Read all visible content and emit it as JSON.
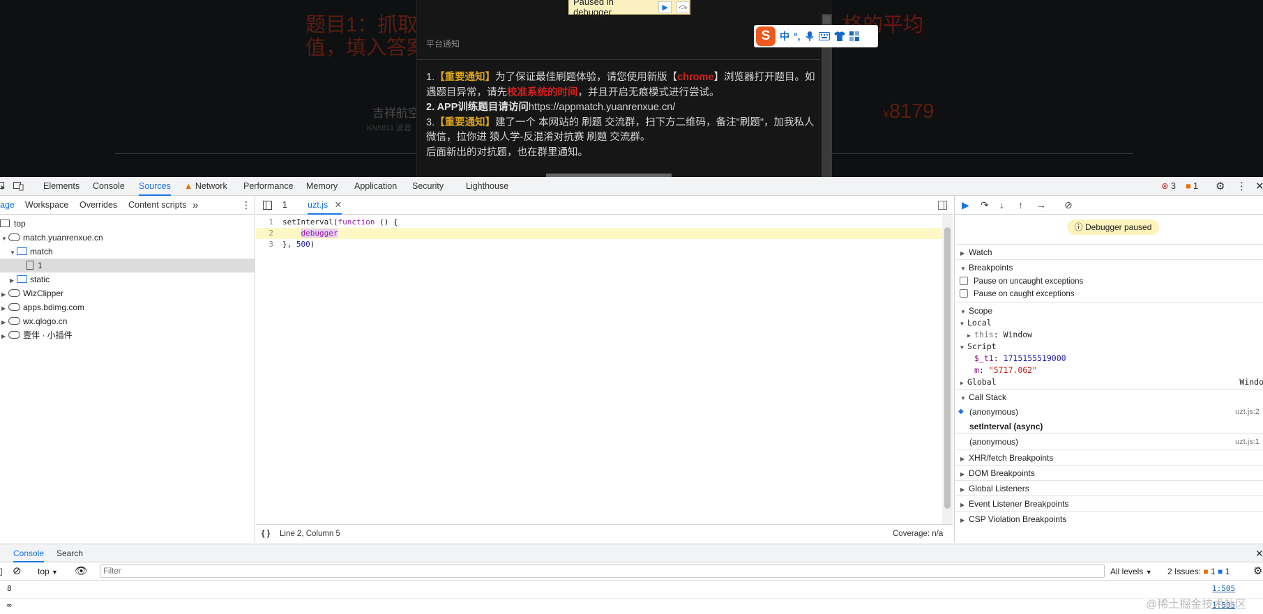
{
  "webpage": {
    "title_line1": "题目1：抓取",
    "title_line2": "值，填入答案",
    "title_right": "格的",
    "title_right_red": "平均",
    "airline": "吉祥航空",
    "flight_no": "KN5911 波音",
    "currency": "¥",
    "price": "8179"
  },
  "notice": {
    "title": "平台通知",
    "l1_num": "1.",
    "l1_tag": "【重要通知】",
    "l1_a": "为了保证最佳刷题体验，请您使用新版【",
    "l1_chrome": "chrome",
    "l1_b": "】浏览器打开题目。如遇题目异常，请先",
    "l1_red": "校准系统的时间",
    "l1_c": "，并且开启无痕模式进行尝试。",
    "l2_bold": "2. APP训练题目请访问",
    "l2_url": "https://appmatch.yuanrenxue.cn/",
    "l3_num": "3.",
    "l3_tag": "【重要通知】",
    "l3_a": "建了一个 本网站的 刷题 交流群，扫下方二维码，备注\"刷题\"，加我私人微信，拉你进 猿人学-反混淆对抗赛 刷题 交流群。",
    "l4": "后面新出的对抗题，也在群里通知。"
  },
  "paused_overlay": {
    "label": "Paused in debugger"
  },
  "ime": {
    "logo": "S",
    "lang": "中",
    "punct": "°,",
    "icons": [
      "mic-icon",
      "keyboard-icon",
      "shirt-icon",
      "grid-icon"
    ]
  },
  "devtools": {
    "tabs": [
      "Elements",
      "Console",
      "Sources",
      "Network",
      "Performance",
      "Memory",
      "Application",
      "Security",
      "Lighthouse"
    ],
    "active_tab": "Sources",
    "errors": "3",
    "issues": "1"
  },
  "navigator": {
    "tabs": [
      "age",
      "Workspace",
      "Overrides",
      "Content scripts"
    ],
    "more": "»",
    "tree": [
      "top",
      "match.yuanrenxue.cn",
      "match",
      "1",
      "static",
      "WizClipper",
      "apps.bdimg.com",
      "wx.qlogo.cn",
      "壹伴 · 小插件"
    ]
  },
  "editor": {
    "tab_other": "1",
    "tab_active": "uzt.js",
    "code": {
      "l1_a": "setInterval(",
      "l1_kw": "function",
      "l1_b": " () {",
      "l2_kw": "debugger",
      "l3_a": "}, ",
      "l3_num": "500",
      "l3_b": ")"
    },
    "line_numbers": [
      "1",
      "2",
      "3"
    ],
    "status_position": "Line 2, Column 5",
    "coverage": "Coverage: n/a"
  },
  "debugger": {
    "paused_label": "Debugger paused",
    "sections": {
      "watch": "Watch",
      "breakpoints": "Breakpoints",
      "pause_uncaught": "Pause on uncaught exceptions",
      "pause_caught": "Pause on caught exceptions",
      "scope": "Scope",
      "local": "Local",
      "this_key": "this",
      "this_val": "Window",
      "script": "Script",
      "t1_key": "$_t1",
      "t1_val": "1715155519000",
      "m_key": "m",
      "m_val": "\"5717.062\"",
      "global": "Global",
      "global_val": "Windo",
      "call_stack": "Call Stack",
      "xhr": "XHR/fetch Breakpoints",
      "dom": "DOM Breakpoints",
      "global_listeners": "Global Listeners",
      "event_listener": "Event Listener Breakpoints",
      "csp": "CSP Violation Breakpoints"
    },
    "call_stack": [
      {
        "fn": "(anonymous)",
        "loc": "uzt.js:2"
      },
      {
        "fn": "setInterval (async)",
        "loc": ""
      },
      {
        "fn": "(anonymous)",
        "loc": "uzt.js:1"
      }
    ]
  },
  "drawer": {
    "tabs": [
      "Console",
      "Search"
    ],
    "context": "top",
    "filter_placeholder": "Filter",
    "levels": "All levels",
    "issues_label": "2 Issues:",
    "issues_a": "1",
    "issues_b": "1",
    "rows": [
      {
        "text": "8",
        "link": "1:505"
      },
      {
        "text": "∞",
        "link": "1:505"
      }
    ]
  },
  "watermark": "@稀土掘金技术社区",
  "colors": {
    "accent": "#1a73e8",
    "paused_bg": "#fbf1c0",
    "highlight_line": "#fff8c5",
    "error": "#d93025"
  }
}
